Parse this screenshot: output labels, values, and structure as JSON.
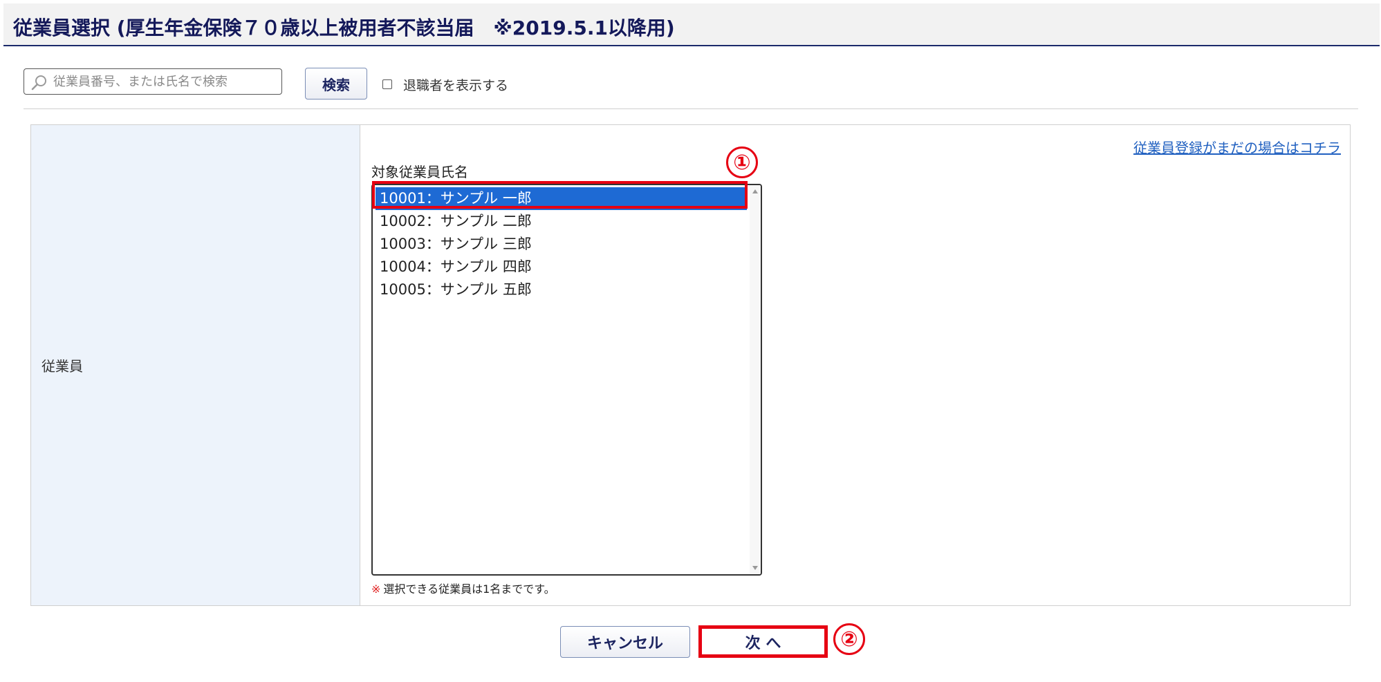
{
  "header": {
    "title": "従業員選択 (厚生年金保険７０歳以上被用者不該当届　※2019.5.1以降用)"
  },
  "search": {
    "placeholder": "従業員番号、または氏名で検索",
    "button_label": "検索",
    "show_retired_label": "退職者を表示する",
    "show_retired_checked": false
  },
  "form": {
    "row_label": "従業員",
    "register_link": "従業員登録がまだの場合はコチラ",
    "list_label": "対象従業員氏名",
    "employees": [
      {
        "label": "10001：サンプル 一郎",
        "selected": true
      },
      {
        "label": "10002：サンプル 二郎",
        "selected": false
      },
      {
        "label": "10003：サンプル 三郎",
        "selected": false
      },
      {
        "label": "10004：サンプル 四郎",
        "selected": false
      },
      {
        "label": "10005：サンプル 五郎",
        "selected": false
      }
    ],
    "note_mark": "※",
    "note_text": "選択できる従業員は1名までです。"
  },
  "footer": {
    "cancel_label": "キャンセル",
    "next_label": "次 へ"
  },
  "annotations": {
    "step1": "①",
    "step2": "②"
  },
  "colors": {
    "highlight": "#e60012",
    "selected": "#1e6ad4",
    "title": "#14195a",
    "link": "#2060c0"
  }
}
